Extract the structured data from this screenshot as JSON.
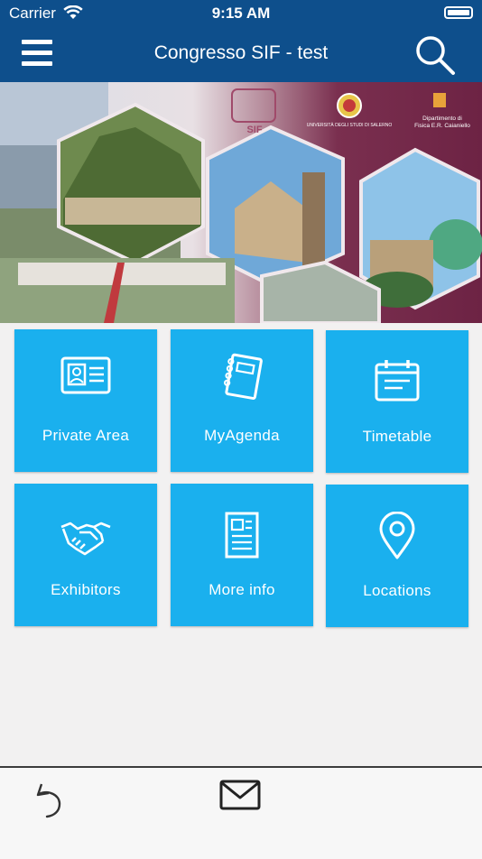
{
  "status_bar": {
    "carrier": "Carrier",
    "time": "9:15 AM"
  },
  "nav": {
    "title": "Congresso SIF - test"
  },
  "banner": {
    "logo_sif": "SIF",
    "university": "UNIVERSITÀ DEGLI STUDI DI SALERNO",
    "dept_line1": "Dipartimento di",
    "dept_line2": "Fisica E.R. Caianiello"
  },
  "tiles": [
    {
      "label": "Private Area",
      "icon": "id-card-icon"
    },
    {
      "label": "MyAgenda",
      "icon": "notebook-icon"
    },
    {
      "label": "Timetable",
      "icon": "calendar-icon"
    },
    {
      "label": "Exhibitors",
      "icon": "handshake-icon"
    },
    {
      "label": "More info",
      "icon": "document-icon"
    },
    {
      "label": "Locations",
      "icon": "location-pin-icon"
    }
  ],
  "colors": {
    "header": "#0e4f8c",
    "tile": "#1ab0ee",
    "background": "#f2f1f1"
  }
}
